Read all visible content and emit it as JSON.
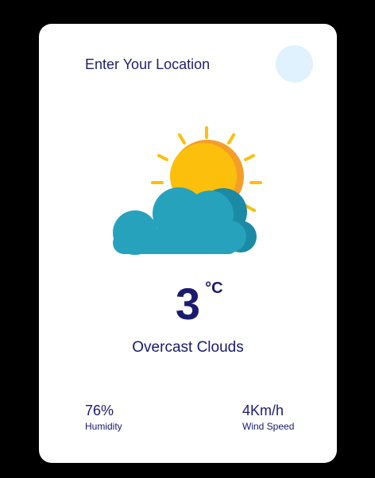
{
  "search": {
    "placeholder": "Enter Your Location",
    "button_icon": "search-icon"
  },
  "weather": {
    "icon": "sun-behind-cloud-icon",
    "temperature": "3",
    "unit": "°C",
    "description": "Overcast Clouds"
  },
  "stats": {
    "humidity": {
      "value": "76%",
      "label": "Humidity"
    },
    "wind": {
      "value": "4Km/h",
      "label": "Wind Speed"
    }
  },
  "colors": {
    "background": "#000000",
    "card": "#ffffff",
    "text": "#1a1a6e",
    "search_button": "#dff2fd",
    "sun": "#fbbf0c",
    "sun_shade": "#f59e27",
    "cloud": "#27a2bd",
    "cloud_shade": "#1b8aa5"
  }
}
